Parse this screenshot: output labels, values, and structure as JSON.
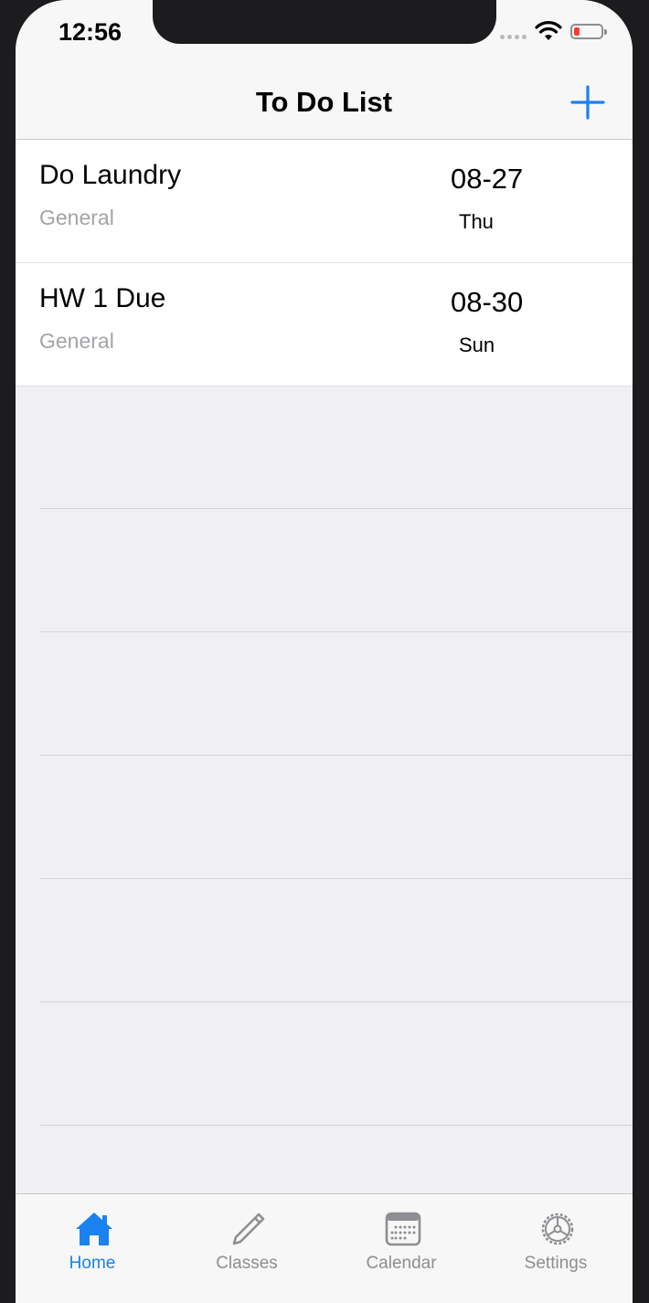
{
  "status_bar": {
    "time": "12:56"
  },
  "nav": {
    "title": "To Do List",
    "add_icon": "plus-icon"
  },
  "tasks": [
    {
      "title": "Do Laundry",
      "category": "General",
      "date": "08-27",
      "day": "Thu"
    },
    {
      "title": "HW 1 Due",
      "category": "General",
      "date": "08-30",
      "day": "Sun"
    }
  ],
  "tabs": [
    {
      "label": "Home",
      "icon": "house-icon",
      "active": true
    },
    {
      "label": "Classes",
      "icon": "pencil-icon",
      "active": false
    },
    {
      "label": "Calendar",
      "icon": "calendar-icon",
      "active": false
    },
    {
      "label": "Settings",
      "icon": "gear-icon",
      "active": false
    }
  ],
  "colors": {
    "accent": "#1a82f0",
    "inactive": "#8e8e93",
    "battery_low": "#ff3b30"
  }
}
